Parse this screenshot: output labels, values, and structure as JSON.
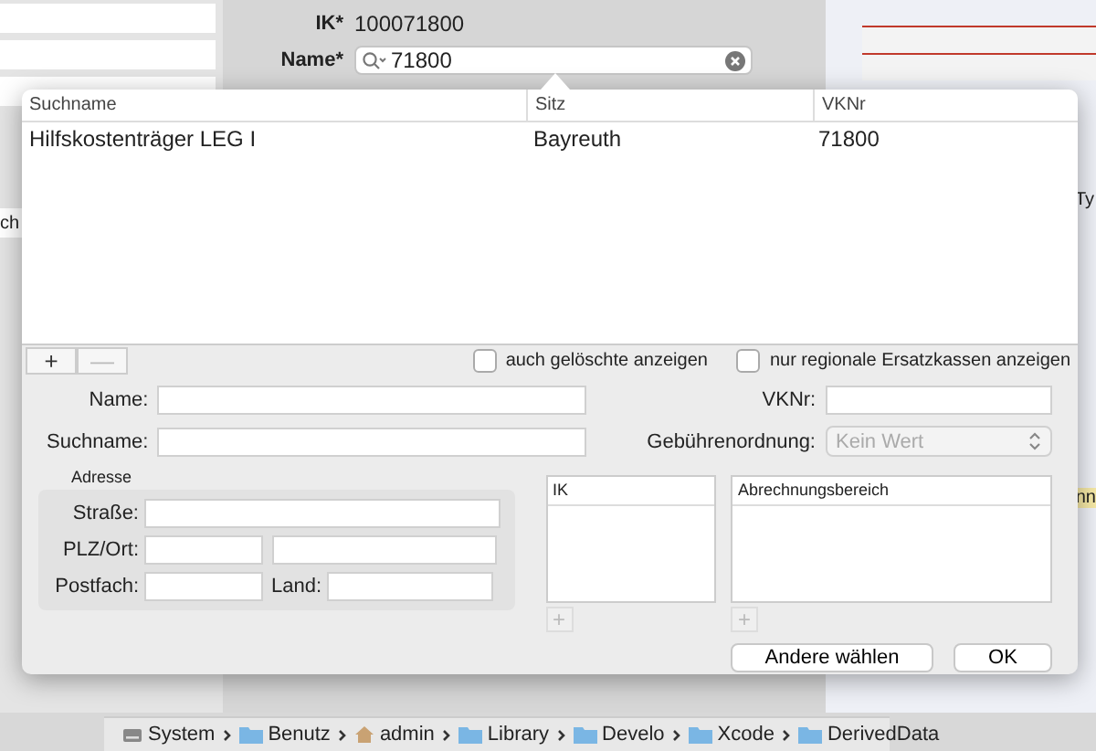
{
  "background": {
    "ik_label": "IK*",
    "ik_value": "100071800",
    "name_label": "Name*",
    "search_value": "71800",
    "left_fragment": "ch",
    "right_fragments": [
      "Ty",
      "nn"
    ]
  },
  "popup": {
    "columns": [
      "Suchname",
      "Sitz",
      "VKNr"
    ],
    "rows": [
      {
        "cells": [
          "Hilfskostenträger LEG I",
          "Bayreuth",
          "71800"
        ],
        "selected": false
      }
    ],
    "add_button": "+",
    "remove_button": "—",
    "remove_disabled": true,
    "checkboxes": [
      {
        "label": "auch gelöschte anzeigen",
        "checked": false
      },
      {
        "label": "nur regionale Ersatzkassen anzeigen",
        "checked": false
      }
    ],
    "form": {
      "name_label": "Name:",
      "suchname_label": "Suchname:",
      "vknr_label": "VKNr:",
      "gebuehr_label": "Gebührenordnung:",
      "gebuehr_value": "Kein Wert",
      "address_title": "Adresse",
      "strasse_label": "Straße:",
      "plz_label": "PLZ/Ort:",
      "postfach_label": "Postfach:",
      "land_label": "Land:"
    },
    "lists": [
      {
        "header": "IK",
        "add": "+"
      },
      {
        "header": "Abrechnungsbereich",
        "add": "+"
      }
    ],
    "buttons": [
      {
        "label": "Andere wählen",
        "kind": "secondary"
      },
      {
        "label": "OK",
        "kind": "default"
      }
    ]
  },
  "path_bar": [
    {
      "label": "System",
      "kind": "drive"
    },
    {
      "label": "Benutz",
      "kind": "folder"
    },
    {
      "label": "admin",
      "kind": "home"
    },
    {
      "label": "Library",
      "kind": "folder"
    },
    {
      "label": "Develo",
      "kind": "folder"
    },
    {
      "label": "Xcode",
      "kind": "folder"
    },
    {
      "label": "DerivedData",
      "kind": "folder"
    }
  ]
}
